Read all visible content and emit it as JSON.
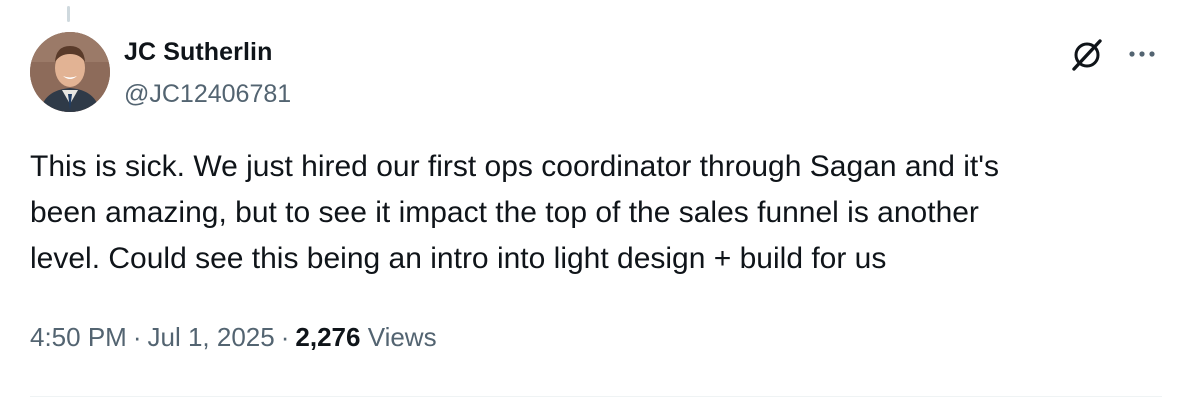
{
  "author": {
    "display_name": "JC Sutherlin",
    "handle": "@JC12406781",
    "avatar_icon": "profile-photo"
  },
  "actions": {
    "grok_icon": "grok-icon",
    "more_icon": "more-icon"
  },
  "tweet": {
    "text": "This is sick. We just hired our first ops coordinator through Sagan and it's\nbeen amazing, but to see it impact the top of the sales funnel is another\nlevel. Could see this being an intro into light design + build for us"
  },
  "meta": {
    "time": "4:50 PM",
    "separator": "·",
    "date": "Jul 1, 2025",
    "views_count": "2,276",
    "views_label": "Views"
  },
  "colors": {
    "text_primary": "#0f1419",
    "text_secondary": "#536471",
    "divider": "#eff3f4"
  }
}
